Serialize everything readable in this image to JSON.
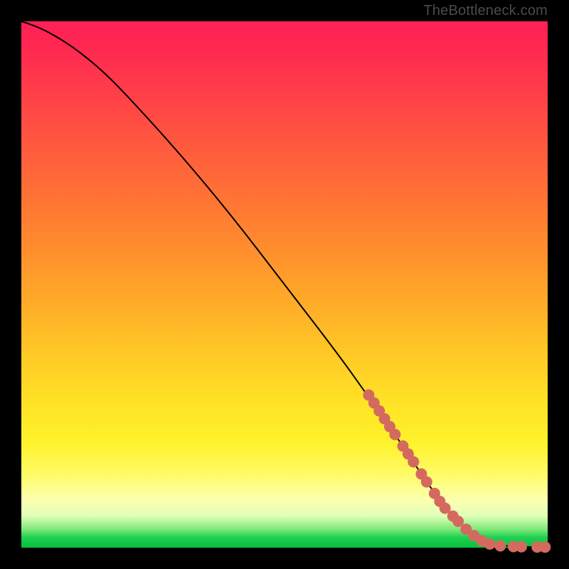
{
  "watermark": "TheBottleneck.com",
  "chart_data": {
    "type": "line",
    "title": "",
    "xlabel": "",
    "ylabel": "",
    "xlim": [
      0,
      100
    ],
    "ylim": [
      0,
      100
    ],
    "grid": false,
    "legend": false,
    "curve": {
      "name": "bottleneck-curve",
      "color": "#000000",
      "points": [
        {
          "x": 0,
          "y": 100
        },
        {
          "x": 3,
          "y": 99
        },
        {
          "x": 6,
          "y": 97.5
        },
        {
          "x": 10,
          "y": 95
        },
        {
          "x": 15,
          "y": 91
        },
        {
          "x": 20,
          "y": 86
        },
        {
          "x": 30,
          "y": 75
        },
        {
          "x": 40,
          "y": 63
        },
        {
          "x": 50,
          "y": 50
        },
        {
          "x": 60,
          "y": 37
        },
        {
          "x": 65,
          "y": 30
        },
        {
          "x": 70,
          "y": 23
        },
        {
          "x": 74,
          "y": 17
        },
        {
          "x": 78,
          "y": 11
        },
        {
          "x": 82,
          "y": 6
        },
        {
          "x": 85,
          "y": 3
        },
        {
          "x": 88,
          "y": 1
        },
        {
          "x": 92,
          "y": 0.3
        },
        {
          "x": 96,
          "y": 0.15
        },
        {
          "x": 100,
          "y": 0.1
        }
      ]
    },
    "markers": {
      "name": "highlighted-points",
      "color": "#d46a5f",
      "radius": 8,
      "points": [
        {
          "x": 66,
          "y": 29
        },
        {
          "x": 67,
          "y": 27.5
        },
        {
          "x": 68,
          "y": 26
        },
        {
          "x": 69,
          "y": 24.5
        },
        {
          "x": 70,
          "y": 23
        },
        {
          "x": 71,
          "y": 21.5
        },
        {
          "x": 72.5,
          "y": 19.3
        },
        {
          "x": 73.5,
          "y": 17.8
        },
        {
          "x": 74.5,
          "y": 16.3
        },
        {
          "x": 76,
          "y": 14
        },
        {
          "x": 77,
          "y": 12.5
        },
        {
          "x": 78.5,
          "y": 10.3
        },
        {
          "x": 79.5,
          "y": 8.8
        },
        {
          "x": 80.5,
          "y": 7.5
        },
        {
          "x": 82,
          "y": 6
        },
        {
          "x": 83,
          "y": 5
        },
        {
          "x": 84.5,
          "y": 3.5
        },
        {
          "x": 86,
          "y": 2.3
        },
        {
          "x": 87.5,
          "y": 1.3
        },
        {
          "x": 89,
          "y": 0.7
        },
        {
          "x": 91,
          "y": 0.35
        },
        {
          "x": 93.5,
          "y": 0.2
        },
        {
          "x": 95,
          "y": 0.17
        },
        {
          "x": 98,
          "y": 0.12
        },
        {
          "x": 99.5,
          "y": 0.1
        }
      ]
    }
  }
}
